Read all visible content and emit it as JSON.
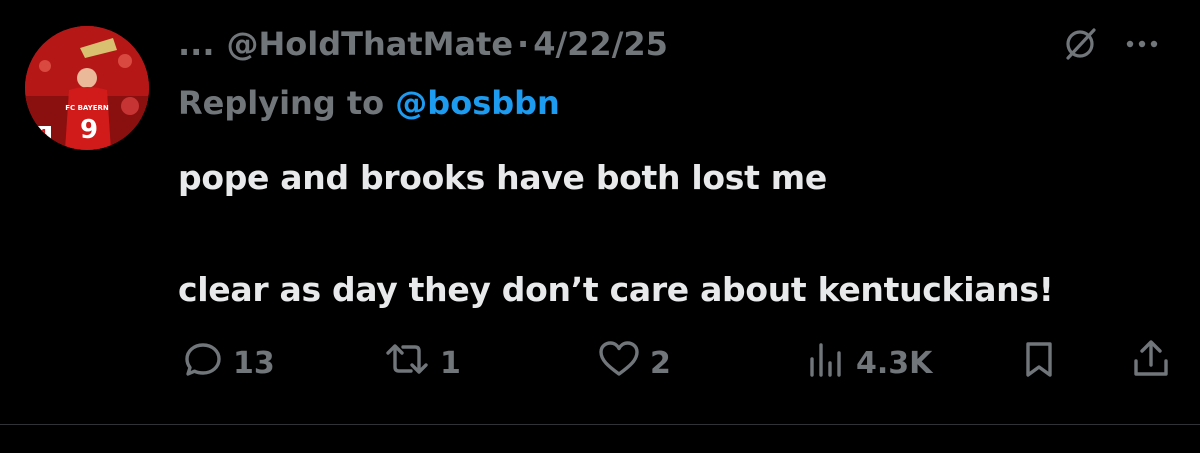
{
  "tweet": {
    "truncated_name": "...",
    "handle": "@HoldThatMate",
    "separator": "·",
    "date": "4/22/25",
    "replying_prefix": "Replying to",
    "replying_handle": "@bosbbn",
    "line1": "pope and brooks have both lost me",
    "line2": "clear as day they don’t care about kentuckians!"
  },
  "avatar": {
    "jersey_text": "FC BAYERN",
    "jersey_number": "9",
    "board_number": "4"
  },
  "actions": {
    "replies": "13",
    "reposts": "1",
    "likes": "2",
    "views": "4.3K"
  },
  "icons": [
    "grok-icon",
    "more-icon",
    "reply-icon",
    "repost-icon",
    "like-icon",
    "views-icon",
    "bookmark-icon",
    "share-icon"
  ],
  "colors": {
    "background": "#000000",
    "text": "#e7e9ea",
    "muted": "#71767b",
    "link": "#1d9bf0"
  }
}
